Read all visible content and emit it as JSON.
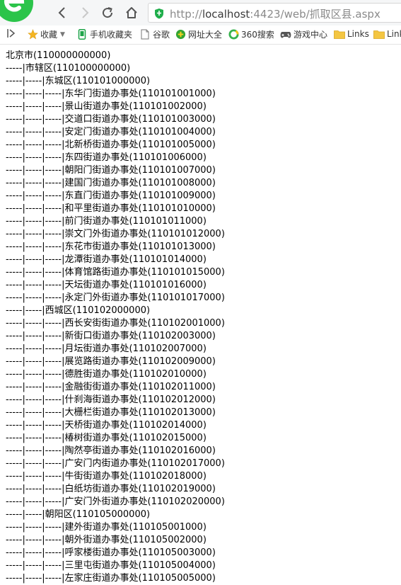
{
  "browser": {
    "url_prefix": "http://",
    "url_host": "localhost",
    "url_rest": ":4423/web/抓取区县.aspx"
  },
  "bookmarks": [
    {
      "label": "收藏",
      "icon": "star-icon"
    },
    {
      "label": "手机收藏夹",
      "icon": "phone-icon"
    },
    {
      "label": "谷歌",
      "icon": "page-icon"
    },
    {
      "label": "网址大全",
      "icon": "url-globe-icon"
    },
    {
      "label": "360搜索",
      "icon": "search-360-icon"
    },
    {
      "label": "游戏中心",
      "icon": "gamepad-icon"
    },
    {
      "label": "Links",
      "icon": "folder-icon"
    },
    {
      "label": "Links",
      "icon": "folder-icon"
    }
  ],
  "lines": [
    "北京市(110000000000)",
    "-----|市辖区(110100000000)",
    "-----|-----|东城区(110101000000)",
    "-----|-----|-----|东华门街道办事处(110101001000)",
    "-----|-----|-----|景山街道办事处(110101002000)",
    "-----|-----|-----|交道口街道办事处(110101003000)",
    "-----|-----|-----|安定门街道办事处(110101004000)",
    "-----|-----|-----|北新桥街道办事处(110101005000)",
    "-----|-----|-----|东四街道办事处(110101006000)",
    "-----|-----|-----|朝阳门街道办事处(110101007000)",
    "-----|-----|-----|建国门街道办事处(110101008000)",
    "-----|-----|-----|东直门街道办事处(110101009000)",
    "-----|-----|-----|和平里街道办事处(110101010000)",
    "-----|-----|-----|前门街道办事处(110101011000)",
    "-----|-----|-----|崇文门外街道办事处(110101012000)",
    "-----|-----|-----|东花市街道办事处(110101013000)",
    "-----|-----|-----|龙潭街道办事处(110101014000)",
    "-----|-----|-----|体育馆路街道办事处(110101015000)",
    "-----|-----|-----|天坛街道办事处(110101016000)",
    "-----|-----|-----|永定门外街道办事处(110101017000)",
    "-----|-----|西城区(110102000000)",
    "-----|-----|-----|西长安街街道办事处(110102001000)",
    "-----|-----|-----|新街口街道办事处(110102003000)",
    "-----|-----|-----|月坛街道办事处(110102007000)",
    "-----|-----|-----|展览路街道办事处(110102009000)",
    "-----|-----|-----|德胜街道办事处(110102010000)",
    "-----|-----|-----|金融街街道办事处(110102011000)",
    "-----|-----|-----|什刹海街道办事处(110102012000)",
    "-----|-----|-----|大栅栏街道办事处(110102013000)",
    "-----|-----|-----|天桥街道办事处(110102014000)",
    "-----|-----|-----|椿树街道办事处(110102015000)",
    "-----|-----|-----|陶然亭街道办事处(110102016000)",
    "-----|-----|-----|广安门内街道办事处(110102017000)",
    "-----|-----|-----|牛街街道办事处(110102018000)",
    "-----|-----|-----|白纸坊街道办事处(110102019000)",
    "-----|-----|-----|广安门外街道办事处(110102020000)",
    "-----|-----|朝阳区(110105000000)",
    "-----|-----|-----|建外街道办事处(110105001000)",
    "-----|-----|-----|朝外街道办事处(110105002000)",
    "-----|-----|-----|呼家楼街道办事处(110105003000)",
    "-----|-----|-----|三里屯街道办事处(110105004000)",
    "-----|-----|-----|左家庄街道办事处(110105005000)"
  ],
  "colors": {
    "logo_green": "#2bc44a",
    "shield_green": "#1fae4b",
    "folder_yellow": "#f4c642",
    "icon_gray": "#555555"
  }
}
